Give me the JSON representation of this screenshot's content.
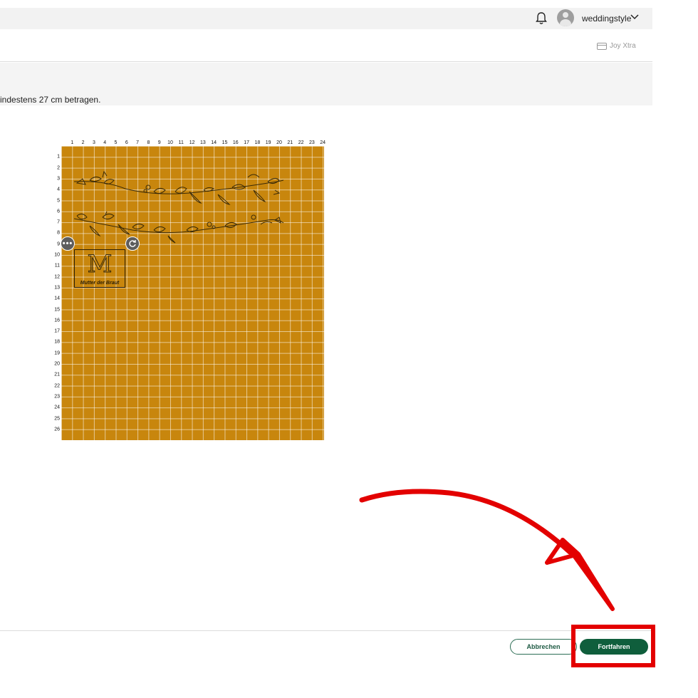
{
  "header": {
    "username": "weddingstyle",
    "icons": [
      "bell-icon",
      "avatar",
      "chevron-down-icon"
    ]
  },
  "subheader": {
    "plan_label": "Joy Xtra",
    "plan_icon": "card-icon"
  },
  "info": {
    "message": "indestens 27 cm betragen."
  },
  "canvas": {
    "board_color": "#c8860d",
    "column_labels": [
      "1",
      "2",
      "3",
      "4",
      "5",
      "6",
      "7",
      "8",
      "9",
      "10",
      "11",
      "12",
      "13",
      "14",
      "15",
      "16",
      "17",
      "18",
      "19",
      "20",
      "21",
      "22",
      "23",
      "24"
    ],
    "row_labels": [
      "1",
      "2",
      "3",
      "4",
      "5",
      "6",
      "7",
      "8",
      "9",
      "10",
      "11",
      "12",
      "13",
      "14",
      "15",
      "16",
      "17",
      "18",
      "19",
      "20",
      "21",
      "22",
      "23",
      "24",
      "25",
      "26"
    ],
    "monogram": {
      "letter": "M",
      "caption": "Mutter der Braut"
    },
    "controls": {
      "more_icon": "more-horizontal-icon",
      "rotate_icon": "rotate-icon"
    }
  },
  "footer": {
    "cancel_label": "Abbrechen",
    "continue_label": "Fortfahren"
  },
  "annotation": {
    "color": "#e30000",
    "shape": "arrow pointing to continue button with highlight box"
  }
}
